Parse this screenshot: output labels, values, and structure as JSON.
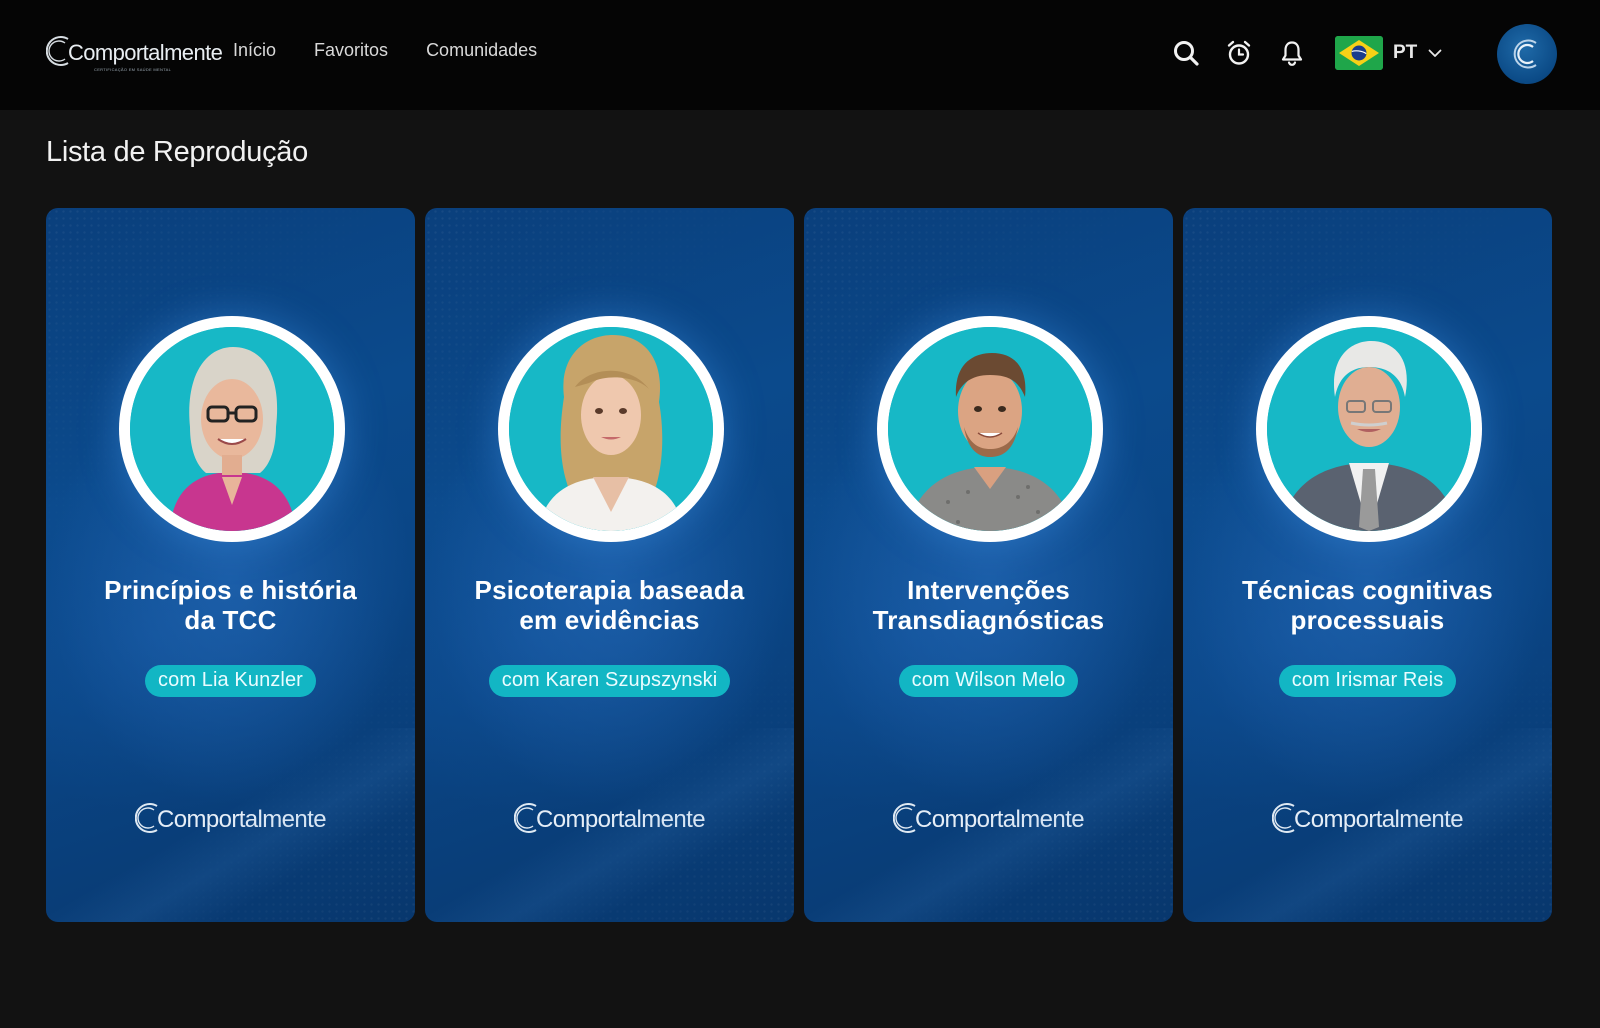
{
  "header": {
    "brand": "Comportalmente",
    "brand_tag": "CERTIFICAÇÃO EM SAÚDE MENTAL",
    "nav": [
      "Início",
      "Favoritos",
      "Comunidades"
    ],
    "language": "PT",
    "icons": [
      "search-icon",
      "alarm-clock-icon",
      "bell-icon",
      "brazil-flag-icon",
      "chevron-down-icon"
    ]
  },
  "page": {
    "title": "Lista de Reprodução"
  },
  "cards": [
    {
      "title": "Princípios e história\nda TCC",
      "instructor": "com Lia Kunzler",
      "logo": "Comportalmente"
    },
    {
      "title": "Psicoterapia baseada\nem evidências",
      "instructor": "com Karen Szupszynski",
      "logo": "Comportalmente"
    },
    {
      "title": "Intervenções\nTransdiagnósticas",
      "instructor": "com Wilson Melo",
      "logo": "Comportalmente"
    },
    {
      "title": "Técnicas cognitivas\nprocessuais",
      "instructor": "com Irismar Reis",
      "logo": "Comportalmente"
    }
  ],
  "colors": {
    "header_bg": "#050505",
    "page_bg": "#121212",
    "card_blue": "#0b4a8c",
    "accent_teal": "#12b6c4"
  }
}
